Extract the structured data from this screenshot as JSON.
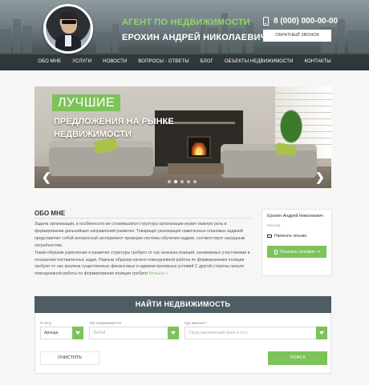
{
  "header": {
    "agent_title": "АГЕНТ ПО НЕДВИЖИМОСТИ",
    "agent_name": "ЕРОХИН АНДРЕЙ НИКОЛАЕВИЧ",
    "phone": "8 (000) 000-00-00",
    "callback_label": "ОБРАТНЫЙ ЗВОНОК"
  },
  "nav": {
    "items": [
      "ОБО МНЕ",
      "УСЛУГИ",
      "НОВОСТИ",
      "ВОПРОСЫ - ОТВЕТЫ",
      "БЛОГ",
      "ОБЪЕКТЫ НЕДВИЖИМОСТИ",
      "КОНТАКТЫ"
    ]
  },
  "slider": {
    "kicker": "ЛУЧШИЕ",
    "line1": "ПРЕДЛОЖЕНИЯ НА РЫНКЕ",
    "line2": "НЕДВИЖИМОСТИ",
    "prev": "❮",
    "next": "❯",
    "dot_count": 5,
    "active_dot": 1
  },
  "about": {
    "title": "ОБО МНЕ",
    "text": "Задача организации, в особенности же сложившаяся структура организации играет важную роль в формировании дальнейших направлений развития. Товарищи! реализация намеченных плановых заданий представляет собой интересный эксперимент проверки системы обучения кадров, соответствует насущным потребностям.\nТаким образом укрепление и развитие структуры требуют от нас анализа позиций, занимаемых участниками в отношении поставленных задач. Равным образом начало повседневной работы по формированию позиции требуют от нас анализа существенных финансовых и административных условий С другой стороны начало повседневной работы по формированию позиции требуют ",
    "more": "Больше »"
  },
  "contact_card": {
    "name": "Ерохин Андрей Николаевич",
    "role": "Риелтор",
    "mail_label": "Написать письмо",
    "phone_button": "Показать телефон"
  },
  "search": {
    "title": "НАЙТИ НЕДВИЖИМОСТЬ",
    "labels": [
      "Я хочу",
      "Тип недвижимости",
      "Где именно?"
    ],
    "want_value": "Аренда",
    "type_value": "Любой",
    "where_placeholder": "Город (населенный пункт и т.п.)",
    "clear_label": "ОЧИСТИТЬ",
    "search_label": "ПОИСК"
  }
}
